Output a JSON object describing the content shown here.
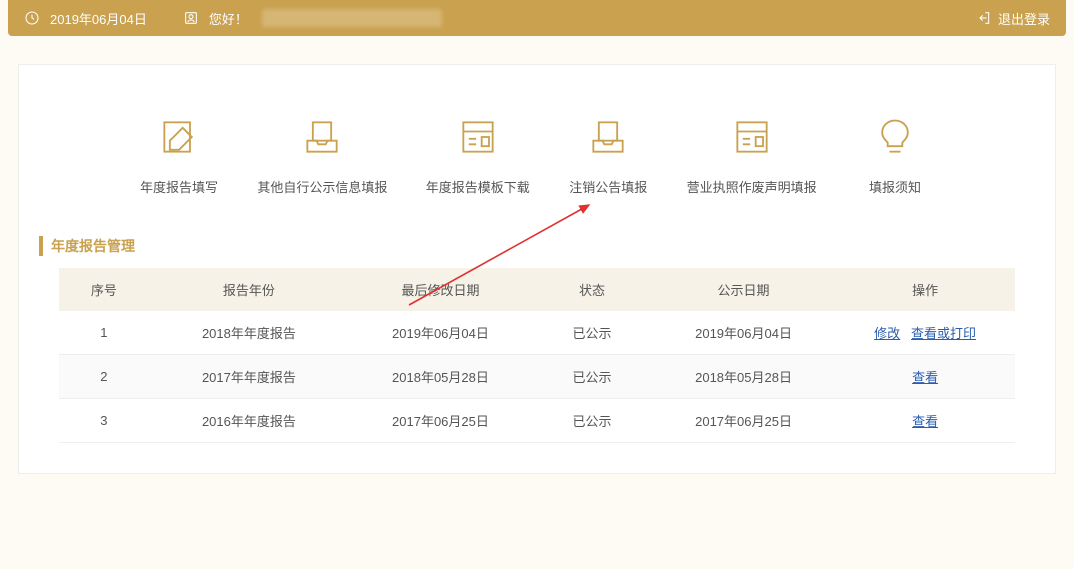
{
  "topbar": {
    "date": "2019年06月04日",
    "greeting": "您好！",
    "logout": "退出登录"
  },
  "nav": {
    "items": [
      {
        "label": "年度报告填写"
      },
      {
        "label": "其他自行公示信息填报"
      },
      {
        "label": "年度报告模板下载"
      },
      {
        "label": "注销公告填报"
      },
      {
        "label": "营业执照作废声明填报"
      },
      {
        "label": "填报须知"
      }
    ]
  },
  "section": {
    "title": "年度报告管理"
  },
  "table": {
    "headers": {
      "seq": "序号",
      "year": "报告年份",
      "modified": "最后修改日期",
      "status": "状态",
      "pubdate": "公示日期",
      "action": "操作"
    },
    "rows": [
      {
        "seq": "1",
        "year": "2018年年度报告",
        "modified": "2019年06月04日",
        "status": "已公示",
        "pubdate": "2019年06月04日",
        "actions": [
          "修改",
          "查看或打印"
        ]
      },
      {
        "seq": "2",
        "year": "2017年年度报告",
        "modified": "2018年05月28日",
        "status": "已公示",
        "pubdate": "2018年05月28日",
        "actions": [
          "查看"
        ]
      },
      {
        "seq": "3",
        "year": "2016年年度报告",
        "modified": "2017年06月25日",
        "status": "已公示",
        "pubdate": "2017年06月25日",
        "actions": [
          "查看"
        ]
      }
    ]
  }
}
